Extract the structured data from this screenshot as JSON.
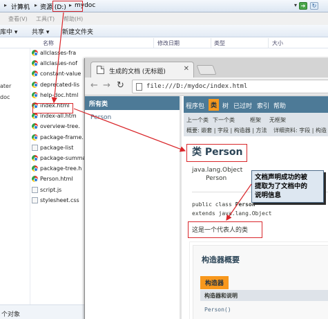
{
  "explorer": {
    "breadcrumb": [
      "计算机",
      "资源 (D:)",
      "mydoc"
    ],
    "menu": [
      "查看(V)",
      "工具(T)",
      "帮助(H)"
    ],
    "toolbar": {
      "include_label": "库中 ▾",
      "share_label": "共享 ▾",
      "new_folder_label": "新建文件夹"
    },
    "columns": [
      "名称",
      "修改日期",
      "类型",
      "大小"
    ],
    "left_items": [
      "ater",
      "doc"
    ],
    "files": [
      {
        "name": "allclasses-fra",
        "kind": "html"
      },
      {
        "name": "allclasses-nof",
        "kind": "html"
      },
      {
        "name": "constant-value",
        "kind": "html"
      },
      {
        "name": "deprecated-lis",
        "kind": "html"
      },
      {
        "name": "help-doc.html",
        "kind": "html"
      },
      {
        "name": "index.html",
        "kind": "html"
      },
      {
        "name": "index-all.htm",
        "kind": "html"
      },
      {
        "name": "overview-tree.",
        "kind": "html"
      },
      {
        "name": "package-frame.",
        "kind": "html"
      },
      {
        "name": "package-list",
        "kind": "doc"
      },
      {
        "name": "package-summar",
        "kind": "html"
      },
      {
        "name": "package-tree.h",
        "kind": "html"
      },
      {
        "name": "Person.html",
        "kind": "html"
      },
      {
        "name": "script.js",
        "kind": "js"
      },
      {
        "name": "stylesheet.css",
        "kind": "css"
      }
    ],
    "status": "个对象"
  },
  "browser": {
    "tab_title": "生成的文档 (无标题)",
    "url": "file:///D:/mydoc/index.html",
    "left_frame": {
      "header": "所有类",
      "classes": [
        "Person"
      ]
    },
    "javadoc": {
      "topnav": [
        "程序包",
        "类",
        "树",
        "已过时",
        "索引",
        "帮助"
      ],
      "active_nav": "类",
      "subnav_row1": [
        "上一个类",
        "下一个类",
        "框架",
        "无框架"
      ],
      "subnav_row2_left": "概要: 嵌套 | 字段 | 构造器 | 方法",
      "subnav_row2_right": "详细资料: 字段 | 构造",
      "class_title": "类 Person",
      "inheritance": [
        "java.lang.Object",
        "Person"
      ],
      "declaration_prefix": "public class ",
      "declaration_name": "Person",
      "declaration_extends": "extends java.lang.Object",
      "description": "这是一个代表人的类",
      "constructor_summary_title": "构造器概要",
      "constructor_tab": "构造器",
      "constructor_column": "构造器和说明",
      "constructor_row": "Person()"
    }
  },
  "annotation": {
    "callout_lines": [
      "文档声明成功的被",
      "提取为了文档中的",
      "说明信息"
    ],
    "highlight_color": "#d9262a"
  }
}
